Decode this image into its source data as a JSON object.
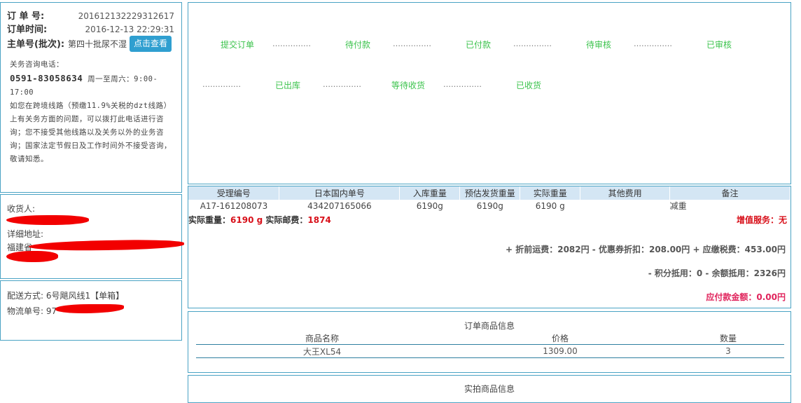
{
  "order": {
    "number_label": "订 单 号:",
    "number": "201612132229312617",
    "time_label": "订单时间:",
    "time": "2016-12-13 22:29:31",
    "batch_label": "主单号(批次):",
    "batch": "第四十批尿不湿",
    "view_button": "点击查看"
  },
  "service": {
    "title": "关务咨询电话：",
    "phone": "0591-83058634",
    "hours": "周一至周六：9:00-17:00",
    "note": "如您在跨境线路（预缴11.9%关税的dzt线路）上有关务方面的问题，可以拨打此电话进行咨询；您不接受其他线路以及关务以外的业务咨询；国家法定节假日及工作时间外不接受咨询，敬请知悉。"
  },
  "receiver": {
    "name_label": "收货人:",
    "address_label": "详细地址:",
    "address_prefix": "福建省"
  },
  "shipping": {
    "method_label": "配送方式:",
    "method": "6号飓风线1【单箱】",
    "tracking_label": "物流单号:",
    "tracking_prefix": "97"
  },
  "status_steps": {
    "row1": [
      "提交订单",
      "待付款",
      "已付款",
      "待审核",
      "已审核"
    ],
    "row2": [
      "已出库",
      "等待收货",
      "已收货"
    ],
    "dots": "……………"
  },
  "weight_table": {
    "headers": [
      "受理编号",
      "日本国内单号",
      "入库重量",
      "预估发货重量",
      "实际重量",
      "其他费用",
      "备注"
    ],
    "row": [
      "A17-161208073",
      "434207165066",
      "6190g",
      "6190g",
      "6190 g",
      "",
      "减重"
    ]
  },
  "weight_summary": {
    "actual_weight_label": "实际重量：",
    "actual_weight": "6190 g",
    "actual_postage_label": "实际邮费：",
    "actual_postage": "1874",
    "addon_label": "增值服务：",
    "addon_value": "无"
  },
  "fees": {
    "line1": "+ 折前运费：2082円 - 优惠券折扣：208.00円 + 应缴税费：453.00円",
    "line2": "- 积分抵用：0 - 余额抵用：2326円",
    "payable": "应付款金额：0.00円"
  },
  "goods": {
    "title": "订单商品信息",
    "headers": [
      "商品名称",
      "价格",
      "数量"
    ],
    "rows": [
      [
        "大王XL54",
        "1309.00",
        "3"
      ]
    ]
  },
  "partial": {
    "title": "实拍商品信息"
  }
}
